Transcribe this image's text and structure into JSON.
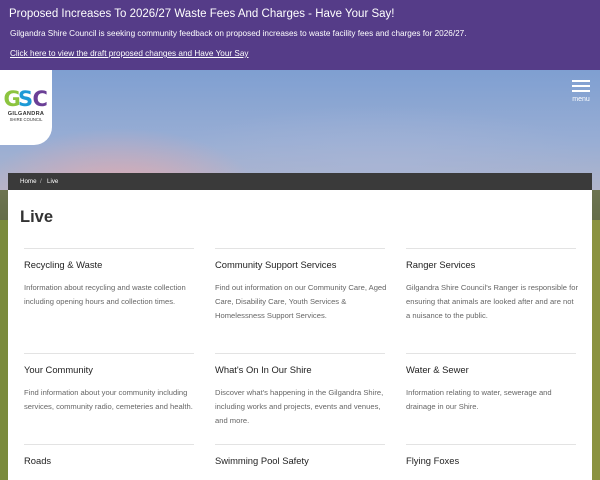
{
  "alert": {
    "title": "Proposed Increases To 2026/27 Waste Fees And Charges - Have Your Say!",
    "body": "Gilgandra Shire Council is seeking community feedback on proposed increases to waste facility fees and charges for 2026/27.",
    "link": "Click here to view the draft proposed changes and Have Your Say"
  },
  "logo": {
    "mark": "GSC",
    "name": "GILGANDRA",
    "subtitle": "SHIRE COUNCIL",
    "colors": {
      "G": "#8cc43f",
      "S": "#1d9ad6",
      "C": "#6a3f96"
    }
  },
  "menu": {
    "label": "menu",
    "icon": "hamburger-icon"
  },
  "breadcrumb": {
    "home": "Home",
    "separator": "/",
    "current": "Live"
  },
  "page": {
    "title": "Live"
  },
  "cards": [
    {
      "title": "Recycling & Waste",
      "desc": "Information about recycling and waste collection including opening hours and collection times."
    },
    {
      "title": "Community Support Services",
      "desc": "Find out information on our Community Care, Aged Care, Disability Care, Youth Services & Homelessness Support Services."
    },
    {
      "title": "Ranger Services",
      "desc": "Gilgandra Shire Council's Ranger is responsible for ensuring that animals are looked after and are not a nuisance to the public."
    },
    {
      "title": "Your Community",
      "desc": "Find information about your community including services, community radio, cemeteries and health."
    },
    {
      "title": "What's On In Our Shire",
      "desc": "Discover what's happening in the Gilgandra Shire, including works and projects, events and venues, and more."
    },
    {
      "title": "Water & Sewer",
      "desc": "Information relating to water, sewerage and drainage in our Shire."
    },
    {
      "title": "Roads",
      "desc": ""
    },
    {
      "title": "Swimming Pool Safety",
      "desc": ""
    },
    {
      "title": "Flying Foxes",
      "desc": ""
    }
  ],
  "colors": {
    "alert_bg": "#553c88",
    "breadcrumb_bg": "#3a3a3a",
    "text": "#333333",
    "muted": "#666666"
  }
}
